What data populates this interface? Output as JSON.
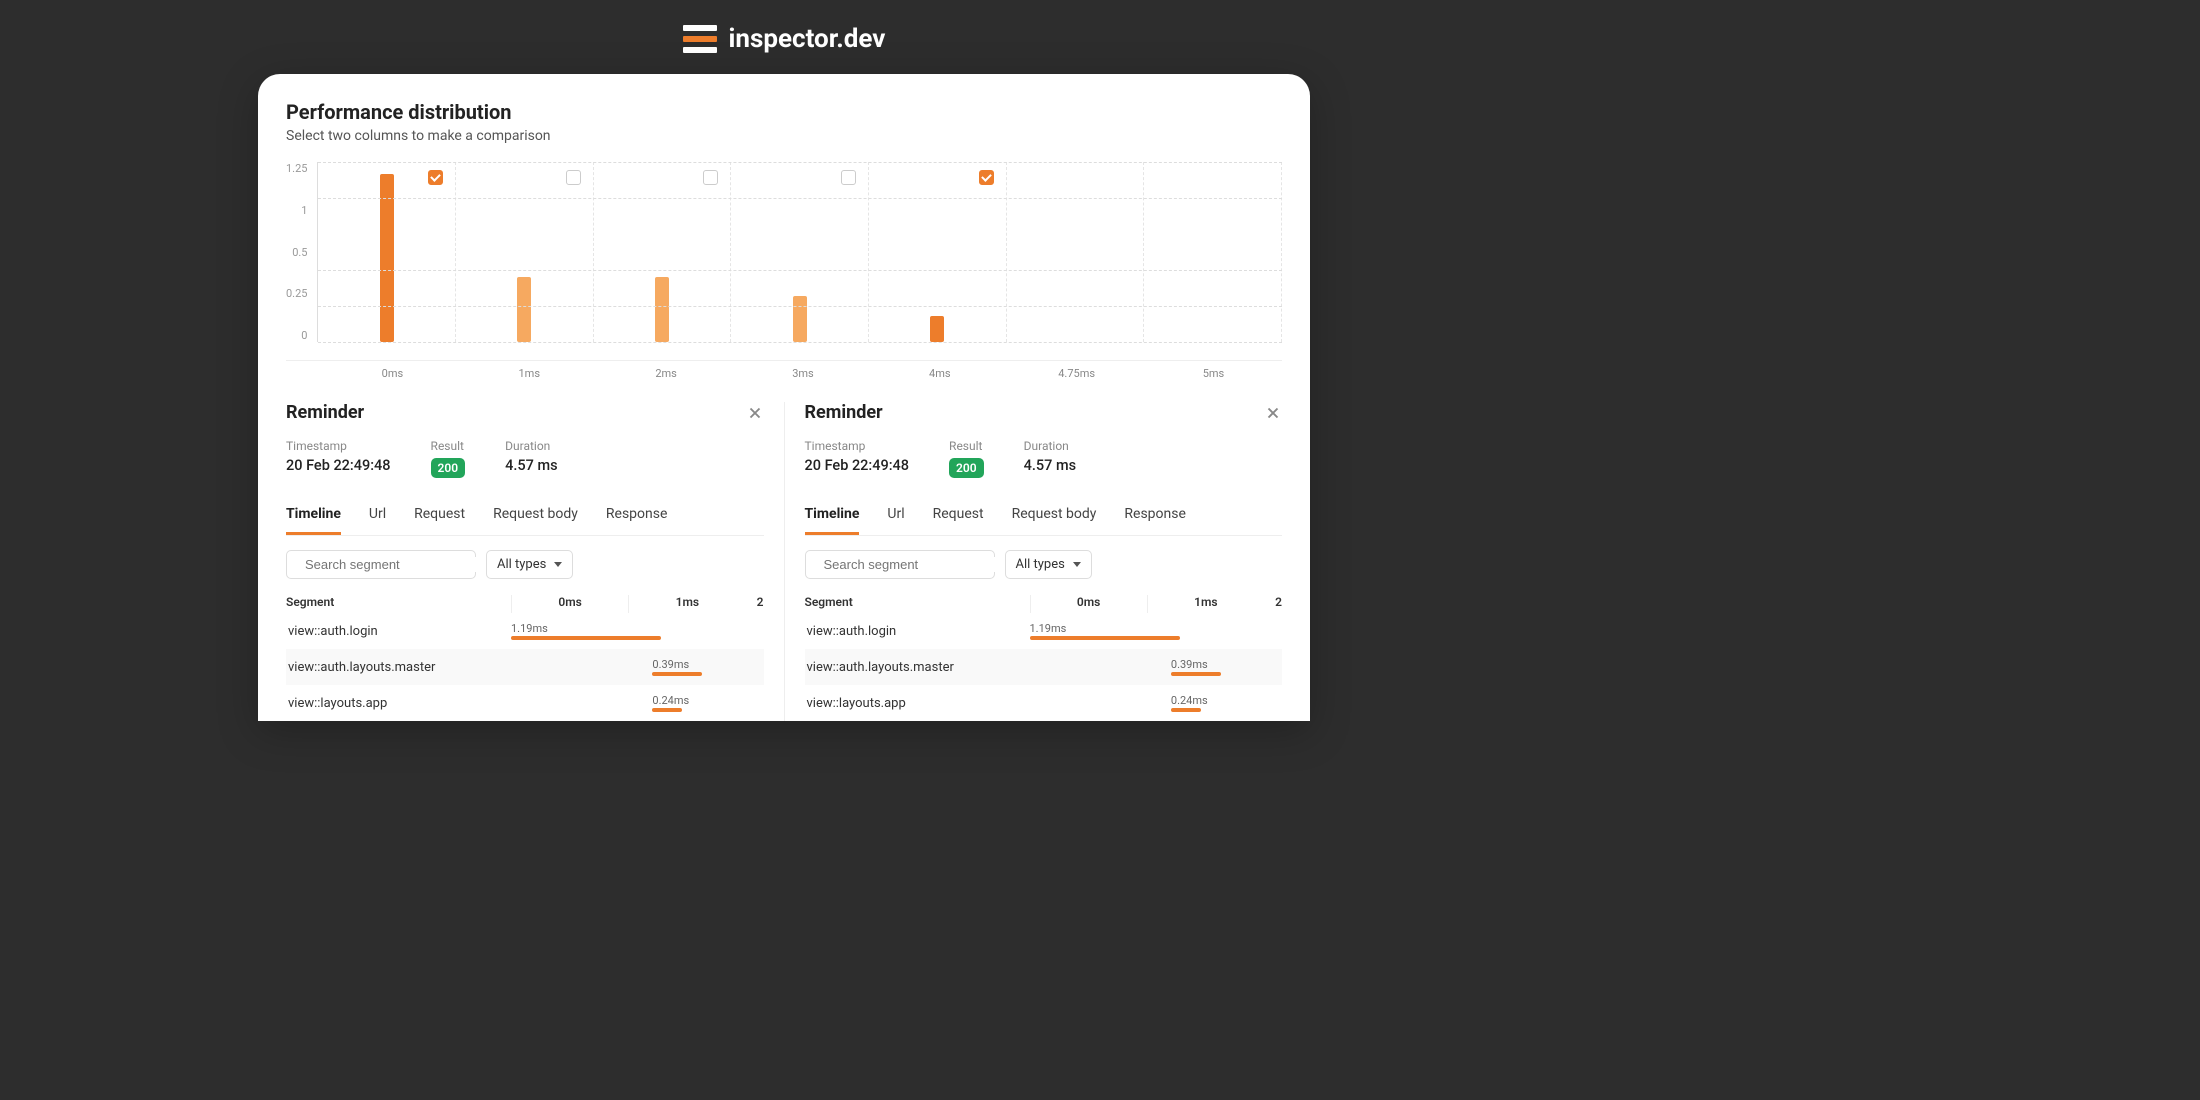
{
  "brand": "inspector.dev",
  "section": {
    "title": "Performance distribution",
    "subtitle": "Select two columns to make a comparison"
  },
  "chart_data": {
    "type": "bar",
    "title": "Performance distribution",
    "xlabel": "",
    "ylabel": "",
    "ylim": [
      0,
      1.25
    ],
    "y_ticks": [
      "1.25",
      "1",
      "0.5",
      "0.25",
      "0"
    ],
    "categories": [
      "0ms",
      "1ms",
      "2ms",
      "3ms",
      "4ms",
      "4.75ms",
      "5ms"
    ],
    "values": [
      1.17,
      0.45,
      0.45,
      0.32,
      0.18,
      0,
      0
    ],
    "selected": [
      true,
      false,
      false,
      false,
      true,
      false,
      false
    ]
  },
  "panels": [
    {
      "title": "Reminder",
      "meta": {
        "timestamp_label": "Timestamp",
        "timestamp": "20 Feb 22:49:48",
        "result_label": "Result",
        "result": "200",
        "duration_label": "Duration",
        "duration": "4.57 ms"
      },
      "tabs": [
        "Timeline",
        "Url",
        "Request",
        "Request body",
        "Response"
      ],
      "active_tab": 0,
      "search_placeholder": "Search segment",
      "types_select": "All types",
      "timeline_header": {
        "segment": "Segment",
        "ticks": [
          "0ms",
          "1ms",
          "2"
        ]
      },
      "segments": [
        {
          "name": "view::auth.login",
          "label": "1.19ms",
          "start_pct": 0,
          "width_pct": 60
        },
        {
          "name": "view::auth.layouts.master",
          "label": "0.39ms",
          "start_pct": 56,
          "width_pct": 20
        },
        {
          "name": "view::layouts.app",
          "label": "0.24ms",
          "start_pct": 56,
          "width_pct": 12
        }
      ]
    },
    {
      "title": "Reminder",
      "meta": {
        "timestamp_label": "Timestamp",
        "timestamp": "20 Feb 22:49:48",
        "result_label": "Result",
        "result": "200",
        "duration_label": "Duration",
        "duration": "4.57 ms"
      },
      "tabs": [
        "Timeline",
        "Url",
        "Request",
        "Request body",
        "Response"
      ],
      "active_tab": 0,
      "search_placeholder": "Search segment",
      "types_select": "All types",
      "timeline_header": {
        "segment": "Segment",
        "ticks": [
          "0ms",
          "1ms",
          "2"
        ]
      },
      "segments": [
        {
          "name": "view::auth.login",
          "label": "1.19ms",
          "start_pct": 0,
          "width_pct": 60
        },
        {
          "name": "view::auth.layouts.master",
          "label": "0.39ms",
          "start_pct": 56,
          "width_pct": 20
        },
        {
          "name": "view::layouts.app",
          "label": "0.24ms",
          "start_pct": 56,
          "width_pct": 12
        }
      ]
    }
  ]
}
